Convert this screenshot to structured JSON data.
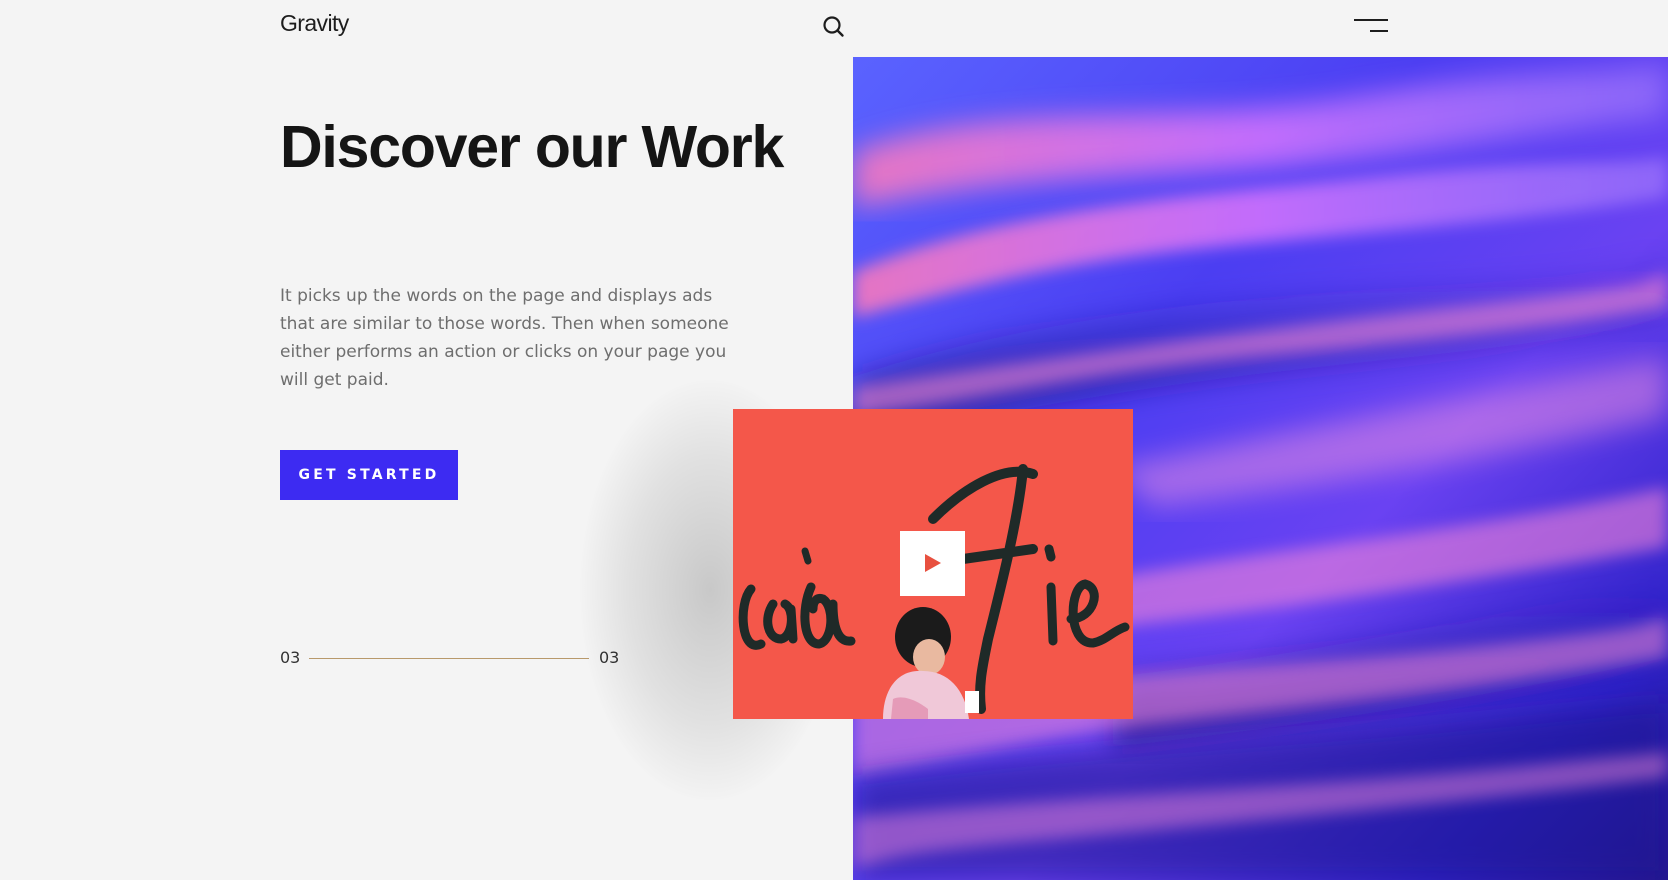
{
  "header": {
    "logo": "Gravity",
    "search_icon": "search-icon",
    "menu_icon": "hamburger-menu-icon"
  },
  "hero": {
    "title": "Discover our Work",
    "description": "It picks up the words on the page and displays ads that are similar to those words. Then when someone either performs an action or clicks on your page you will get paid.",
    "cta_label": "GET STARTED"
  },
  "slider": {
    "current": "03",
    "total": "03"
  },
  "video": {
    "play_icon": "play-icon"
  },
  "colors": {
    "accent": "#3d2bf2",
    "background": "#f4f4f4",
    "slider_line": "#b8996b",
    "video_bg": "#f4574a"
  }
}
